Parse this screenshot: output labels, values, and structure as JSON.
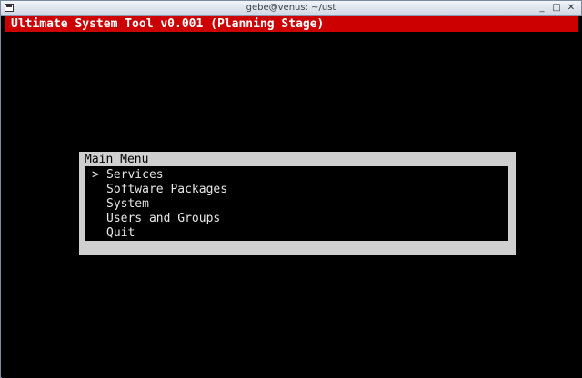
{
  "window": {
    "title": "gebe@venus: ~/ust",
    "controls": [
      "_",
      "□",
      "✕"
    ]
  },
  "header": {
    "title": "Ultimate System Tool v0.001 (Planning Stage)"
  },
  "dialog": {
    "title": "Main Menu",
    "selection_marker": ">",
    "items": [
      {
        "label": "Services",
        "selected": true
      },
      {
        "label": "Software Packages",
        "selected": false
      },
      {
        "label": "System",
        "selected": false
      },
      {
        "label": "Users and Groups",
        "selected": false
      },
      {
        "label": "Quit",
        "selected": false
      }
    ]
  },
  "colors": {
    "header_bg": "#cc0000",
    "terminal_bg": "#000000",
    "dialog_bg": "#cfcfcf",
    "menu_text": "#e6e6e6"
  },
  "icons": {
    "window_icon": "terminal-icon",
    "minimize": "minimize-icon",
    "maximize": "maximize-icon",
    "close": "close-icon"
  }
}
